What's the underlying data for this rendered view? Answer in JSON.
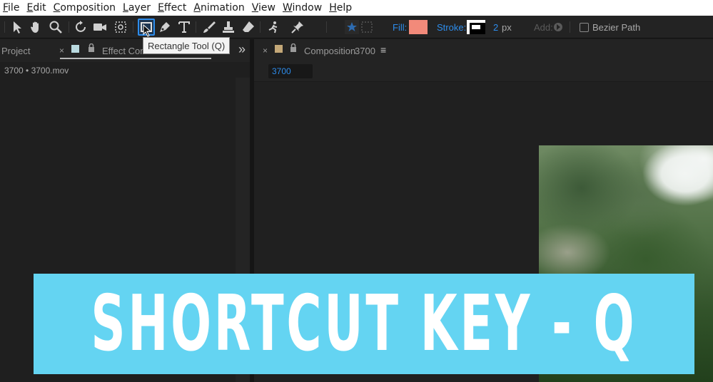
{
  "menu": {
    "items": [
      "File",
      "Edit",
      "Composition",
      "Layer",
      "Effect",
      "Animation",
      "View",
      "Window",
      "Help"
    ]
  },
  "toolbar": {
    "tools": [
      "selection-tool",
      "hand-tool",
      "zoom-tool",
      "rotation-tool",
      "camera-tool",
      "pan-behind-tool",
      "rectangle-tool",
      "pen-tool",
      "type-tool",
      "brush-tool",
      "clone-stamp-tool",
      "eraser-tool",
      "roto-brush-tool",
      "puppet-pin-tool"
    ],
    "fill_label": "Fill:",
    "fill_color": "#f28a7a",
    "stroke_label": "Stroke:",
    "stroke_width": "2",
    "stroke_unit": "px",
    "add_label": "Add:",
    "bezier_label": "Bezier Path"
  },
  "tooltip": {
    "text": "Rectangle Tool (Q)"
  },
  "left_panel": {
    "tab_project": "Project",
    "tab_effect": "Effect Cont",
    "file_label": "3700 • 3700.mov"
  },
  "composition_panel": {
    "tab_label": "Composition",
    "tab_name": "3700",
    "comp_badge": "3700"
  },
  "overlay": {
    "text": "SHORTCUT KEY - Q",
    "bg_color": "#64d4f2"
  }
}
